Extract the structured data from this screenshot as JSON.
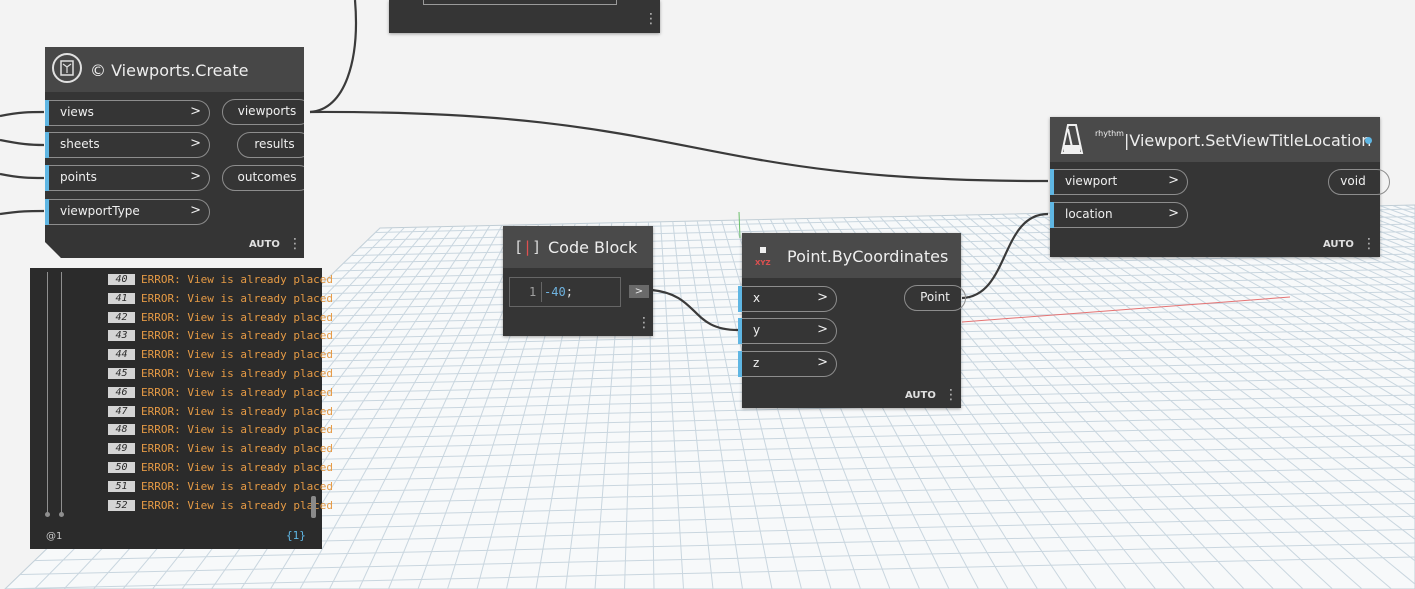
{
  "viewports_create": {
    "title": "© Viewports.Create",
    "icon": "viewports-icon",
    "inputs": [
      "views",
      "sheets",
      "points",
      "viewportType"
    ],
    "outputs": [
      "viewports",
      "results",
      "outcomes"
    ],
    "lacing": "AUTO"
  },
  "watch": {
    "rows": [
      {
        "index": "40",
        "text": "ERROR: View is already placed"
      },
      {
        "index": "41",
        "text": "ERROR: View is already placed"
      },
      {
        "index": "42",
        "text": "ERROR: View is already placed"
      },
      {
        "index": "43",
        "text": "ERROR: View is already placed"
      },
      {
        "index": "44",
        "text": "ERROR: View is already placed"
      },
      {
        "index": "45",
        "text": "ERROR: View is already placed"
      },
      {
        "index": "46",
        "text": "ERROR: View is already placed"
      },
      {
        "index": "47",
        "text": "ERROR: View is already placed"
      },
      {
        "index": "48",
        "text": "ERROR: View is already placed"
      },
      {
        "index": "49",
        "text": "ERROR: View is already placed"
      },
      {
        "index": "50",
        "text": "ERROR: View is already placed"
      },
      {
        "index": "51",
        "text": "ERROR: View is already placed"
      },
      {
        "index": "52",
        "text": "ERROR: View is already placed"
      }
    ],
    "level": "@1",
    "count": "{1}"
  },
  "code_block": {
    "title": "Code Block",
    "icon_text": "[]",
    "line_number": "1",
    "code_value": "-40",
    "code_semicolon": ";",
    "output_symbol": ">"
  },
  "point_node": {
    "title": "Point.ByCoordinates",
    "icon_text": "XYZ",
    "inputs": [
      "x",
      "y",
      "z"
    ],
    "outputs": [
      "Point"
    ],
    "lacing": "AUTO"
  },
  "viewport_node": {
    "title": "|Viewport.SetViewTitleLocation",
    "prefix": "rhythm",
    "icon": "metronome-icon",
    "inputs": [
      "viewport",
      "location"
    ],
    "outputs": [
      "void"
    ],
    "lacing": "AUTO"
  },
  "colors": {
    "node_body": "#353535",
    "node_header": "#4a4a4a",
    "port_bar": "#5fb6e3",
    "error_text": "#e59a45",
    "canvas": "#f3f3f3",
    "grid": "#c5d3dc",
    "x_axis": "#e57373",
    "y_axis": "#6bbf6b"
  }
}
